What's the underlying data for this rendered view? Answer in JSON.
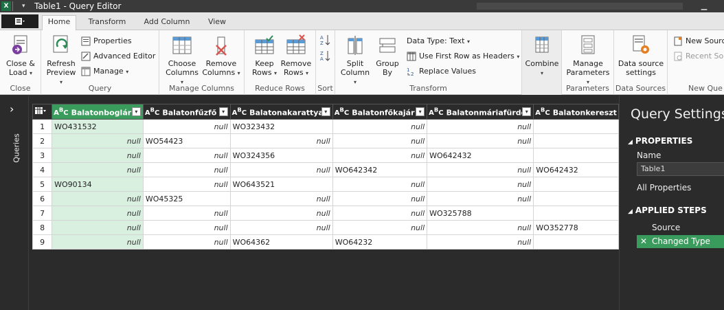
{
  "window": {
    "title": "Table1 - Query Editor",
    "app_icon": "X"
  },
  "tabs": [
    {
      "label": "Home",
      "active": true
    },
    {
      "label": "Transform",
      "active": false
    },
    {
      "label": "Add Column",
      "active": false
    },
    {
      "label": "View",
      "active": false
    }
  ],
  "ribbon": {
    "close": {
      "close_load": "Close &",
      "close_load2": "Load",
      "group": "Close"
    },
    "query": {
      "refresh": "Refresh",
      "refresh2": "Preview",
      "properties": "Properties",
      "advanced": "Advanced Editor",
      "manage": "Manage",
      "group": "Query"
    },
    "manage_columns": {
      "choose": "Choose",
      "choose2": "Columns",
      "remove": "Remove",
      "remove2": "Columns",
      "group": "Manage Columns"
    },
    "reduce_rows": {
      "keep": "Keep",
      "keep2": "Rows",
      "remove": "Remove",
      "remove2": "Rows",
      "group": "Reduce Rows"
    },
    "sort": {
      "group": "Sort"
    },
    "transform": {
      "split": "Split",
      "split2": "Column",
      "group_by": "Group",
      "group_by2": "By",
      "data_type": "Data Type: Text",
      "first_row": "Use First Row as Headers",
      "replace": "Replace Values",
      "group": "Transform"
    },
    "combine": {
      "label": "Combine"
    },
    "parameters": {
      "manage": "Manage",
      "manage2": "Parameters",
      "group": "Parameters"
    },
    "data_sources": {
      "settings": "Data source",
      "settings2": "settings",
      "group": "Data Sources"
    },
    "new_query": {
      "new_source": "New Sourc",
      "recent": "Recent Sou",
      "group": "New Que"
    }
  },
  "queries_pane": {
    "label": "Queries"
  },
  "grid": {
    "columns": [
      "Balatonboglár",
      "Balatonfűzfő",
      "Balatonakarattya",
      "Balatonfőkajár",
      "Balatonmáriafürdő",
      "Balatonkereszt"
    ],
    "rows": [
      [
        "1",
        "WO431532",
        "null",
        "WO323432",
        "null",
        "null",
        ""
      ],
      [
        "2",
        "null",
        "WO54423",
        "null",
        "null",
        "null",
        ""
      ],
      [
        "3",
        "null",
        "null",
        "WO324356",
        "null",
        "WO642432",
        ""
      ],
      [
        "4",
        "null",
        "null",
        "null",
        "WO642342",
        "null",
        "WO642432"
      ],
      [
        "5",
        "WO90134",
        "null",
        "WO643521",
        "null",
        "null",
        ""
      ],
      [
        "6",
        "null",
        "WO45325",
        "null",
        "null",
        "null",
        ""
      ],
      [
        "7",
        "null",
        "null",
        "null",
        "null",
        "WO325788",
        ""
      ],
      [
        "8",
        "null",
        "null",
        "null",
        "null",
        "null",
        "WO352778"
      ],
      [
        "9",
        "null",
        "null",
        "WO64362",
        "WO64232",
        "null",
        ""
      ]
    ]
  },
  "settings": {
    "title": "Query Settings",
    "properties": "PROPERTIES",
    "name_label": "Name",
    "name_value": "Table1",
    "all_properties": "All Properties",
    "applied_steps": "APPLIED STEPS",
    "steps": [
      "Source",
      "Changed Type"
    ]
  }
}
